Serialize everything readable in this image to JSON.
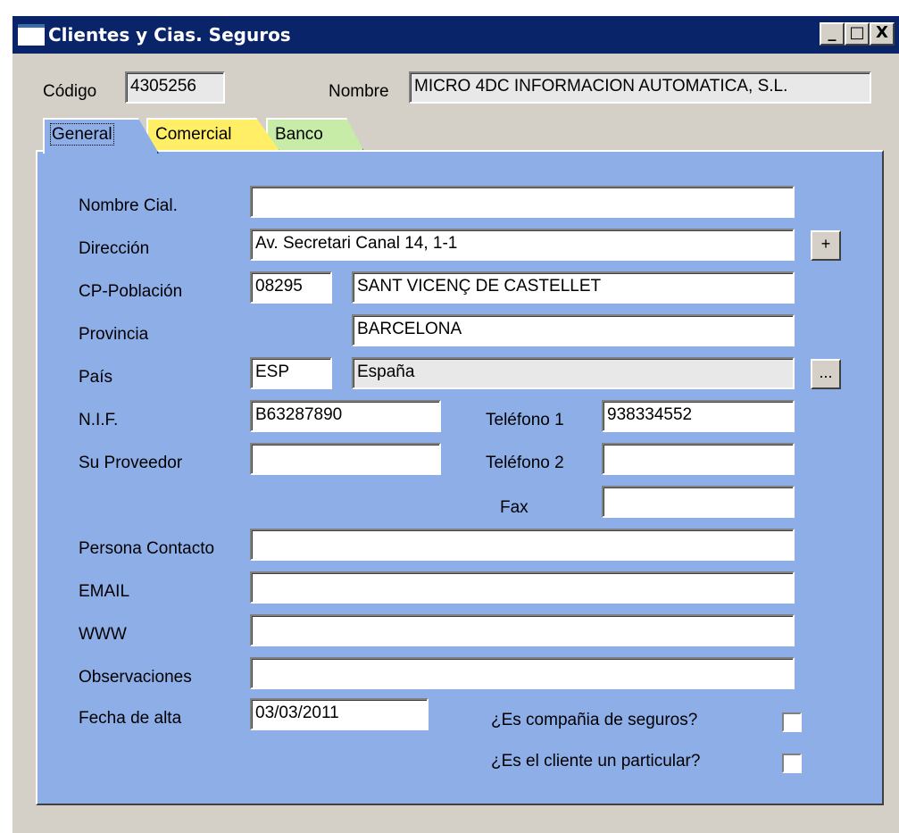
{
  "window": {
    "title": "Clientes y Cias. Seguros",
    "controls": {
      "minimize": "_",
      "maximize": "□",
      "close": "X"
    }
  },
  "header": {
    "codigo_label": "Código",
    "codigo_value": "4305256",
    "nombre_label": "Nombre",
    "nombre_value": "MICRO 4DC INFORMACION AUTOMATICA, S.L."
  },
  "tabs": [
    {
      "label": "General",
      "color": "#8eaee8",
      "active": true
    },
    {
      "label": "Comercial",
      "color": "#ffee66",
      "active": false
    },
    {
      "label": "Banco",
      "color": "#c6eca8",
      "active": false
    }
  ],
  "form": {
    "nombre_cial_label": "Nombre Cial.",
    "nombre_cial_value": "",
    "direccion_label": "Dirección",
    "direccion_value": "Av. Secretari Canal 14, 1-1",
    "direccion_button": "+",
    "cp_poblacion_label": "CP-Población",
    "cp_value": "08295",
    "poblacion_value": "SANT VICENÇ DE CASTELLET",
    "provincia_label": "Provincia",
    "provincia_value": "BARCELONA",
    "pais_label": "País",
    "pais_code": "ESP",
    "pais_name": "España",
    "pais_button": "...",
    "nif_label": "N.I.F.",
    "nif_value": "B63287890",
    "telefono1_label": "Teléfono 1",
    "telefono1_value": "938334552",
    "su_proveedor_label": "Su Proveedor",
    "su_proveedor_value": "",
    "telefono2_label": "Teléfono 2",
    "telefono2_value": "",
    "fax_label": "Fax",
    "fax_value": "",
    "persona_contacto_label": "Persona Contacto",
    "persona_contacto_value": "",
    "email_label": "EMAIL",
    "email_value": "",
    "www_label": "WWW",
    "www_value": "",
    "observaciones_label": "Observaciones",
    "observaciones_value": "",
    "fecha_alta_label": "Fecha de alta",
    "fecha_alta_value": "03/03/2011",
    "es_compania_label": "¿Es compañia de seguros?",
    "es_compania_checked": false,
    "es_particular_label": "¿Es el cliente un particular?",
    "es_particular_checked": false
  },
  "colors": {
    "titlebar": "#0a246a",
    "panel": "#8eaee8",
    "dialog": "#d4d0c8"
  }
}
